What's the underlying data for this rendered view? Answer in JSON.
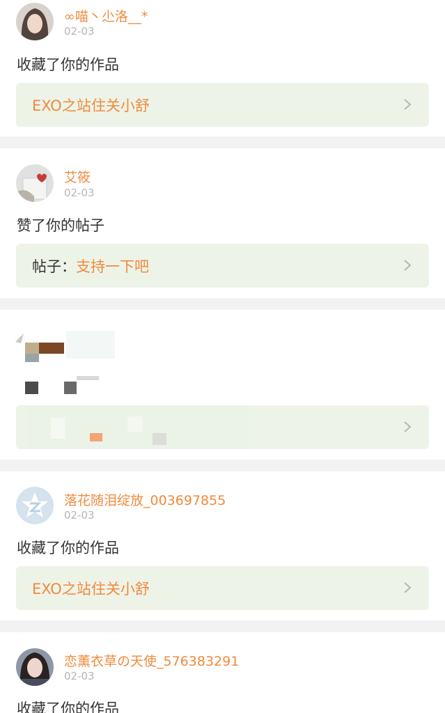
{
  "colors": {
    "accent": "#f08a3c",
    "text": "#333333",
    "muted": "#b5b5b5",
    "link_bg": "#eef3e8",
    "page_bg": "#f2f2f2"
  },
  "notifications": [
    {
      "user": "∞喵丶尐洛__*",
      "time": "02-03",
      "action": "收藏了你的作品",
      "link": {
        "prefix": "",
        "text": "EXO之站住关小舒"
      }
    },
    {
      "user": "艾筱",
      "time": "02-03",
      "action": "赞了你的帖子",
      "link": {
        "prefix": "帖子：",
        "text": "支持一下吧"
      }
    },
    {
      "user": "",
      "time": "",
      "action": "",
      "link": {
        "prefix": "",
        "text": ""
      }
    },
    {
      "user": "落花随泪绽放_003697855",
      "time": "02-03",
      "action": "收藏了你的作品",
      "link": {
        "prefix": "",
        "text": "EXO之站住关小舒"
      }
    },
    {
      "user": "恋薰衣草の天使_576383291",
      "time": "02-03",
      "action": "收藏了你的作品",
      "link": {
        "prefix": "",
        "text": ""
      }
    }
  ],
  "icons": {
    "chevron": "chevron-right-icon",
    "avatar_default": "qzone-star-icon"
  }
}
